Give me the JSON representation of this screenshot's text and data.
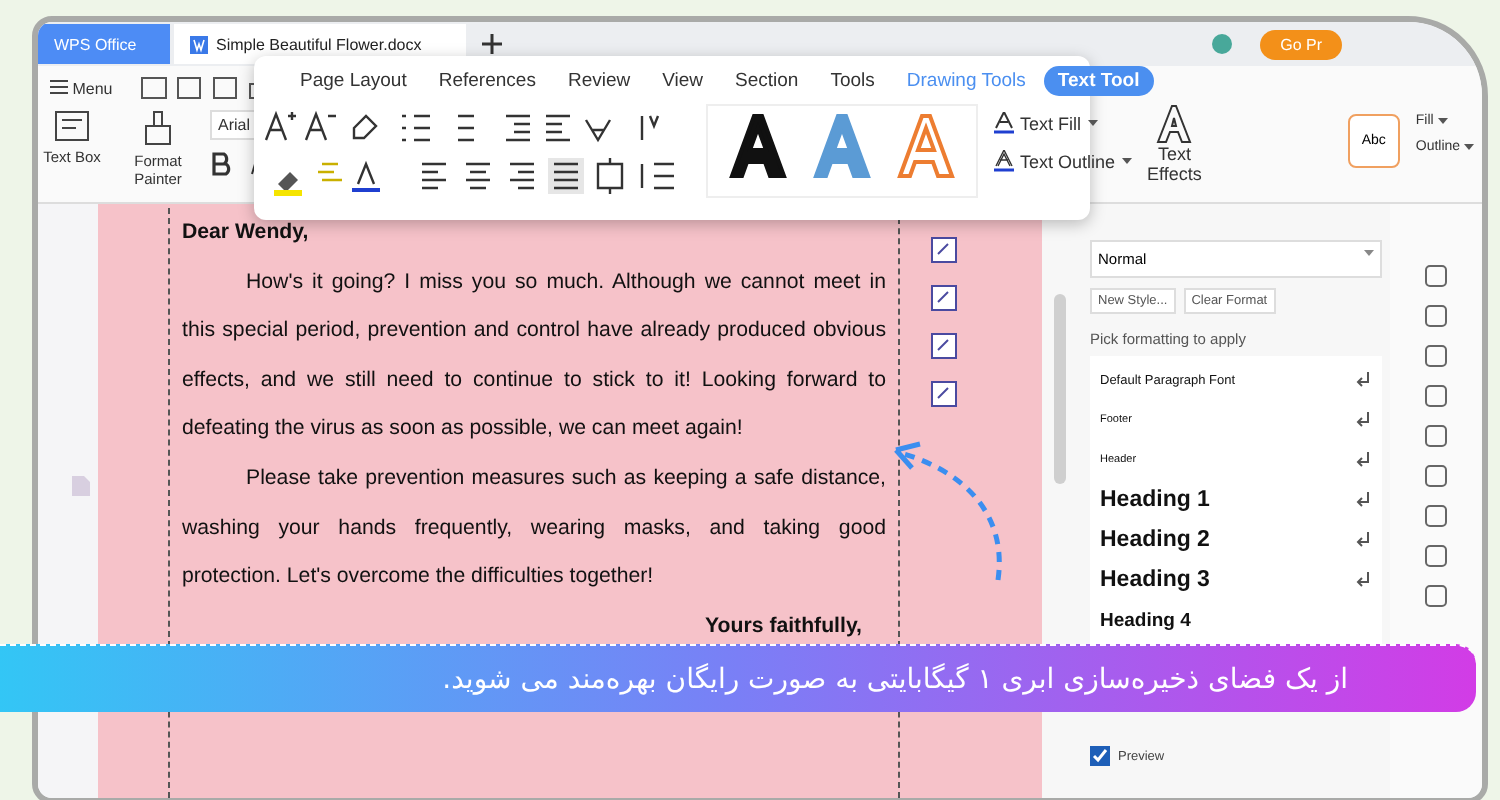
{
  "tabs": [
    {
      "label": "WPS Office",
      "selected": false
    },
    {
      "label": "Simple Beautiful Flower.docx",
      "selected": true
    }
  ],
  "premium_button": "Go Pr",
  "toolbar": {
    "menu": "Menu",
    "font": "Arial",
    "text_box": "Text Box",
    "format_painter": "Format Painter",
    "fill": "Fill",
    "outline": "Outline",
    "style_sample": "Abc"
  },
  "ribbon_tabs": [
    {
      "label": "Page Layout",
      "selected": false,
      "kind": "plain"
    },
    {
      "label": "References",
      "selected": false,
      "kind": "plain"
    },
    {
      "label": "Review",
      "selected": false,
      "kind": "plain"
    },
    {
      "label": "View",
      "selected": false,
      "kind": "plain"
    },
    {
      "label": "Section",
      "selected": false,
      "kind": "plain"
    },
    {
      "label": "Tools",
      "selected": false,
      "kind": "plain"
    },
    {
      "label": "Drawing Tools",
      "selected": false,
      "kind": "context"
    },
    {
      "label": "Text Tool",
      "selected": true,
      "kind": "context"
    }
  ],
  "text_styles": [
    {
      "color": "#111111"
    },
    {
      "color": "#5b9bd5"
    },
    {
      "color": "#ed7d31"
    }
  ],
  "text_controls": {
    "fill": "Text Fill",
    "outline": "Text Outline",
    "effects": "Text Effects"
  },
  "document": {
    "greeting": "Dear Wendy,",
    "paragraphs": [
      "How's it going? I miss you so much. Although we cannot meet in this special period, prevention and control have already produced obvious effects, and we still need to continue to stick to it! Looking forward to defeating the virus as soon as possible, we can meet again!",
      "Please take prevention measures such as keeping a safe distance, washing your hands frequently, wearing masks, and taking good protection. Let's overcome the difficulties together!"
    ],
    "closing": "Yours faithfully,"
  },
  "styles_panel": {
    "current_style": "Normal",
    "buttons": [
      "New Style...",
      "Clear Format"
    ],
    "hint": "Pick formatting to apply",
    "styles": [
      {
        "name": "Default Paragraph Font",
        "kind": "character"
      },
      {
        "name": "Footer",
        "kind": "small"
      },
      {
        "name": "Header",
        "kind": "small"
      },
      {
        "name": "Heading 1",
        "kind": "heading"
      },
      {
        "name": "Heading 2",
        "kind": "heading"
      },
      {
        "name": "Heading 3",
        "kind": "heading"
      },
      {
        "name": "Heading 4",
        "kind": "heading4"
      }
    ],
    "preview": {
      "label": "Preview",
      "checked": true
    }
  },
  "banner": "از یک فضای ذخیره‌سازی ابری ۱ گیگابایتی به صورت رایگان بهره‌مند می شوید."
}
